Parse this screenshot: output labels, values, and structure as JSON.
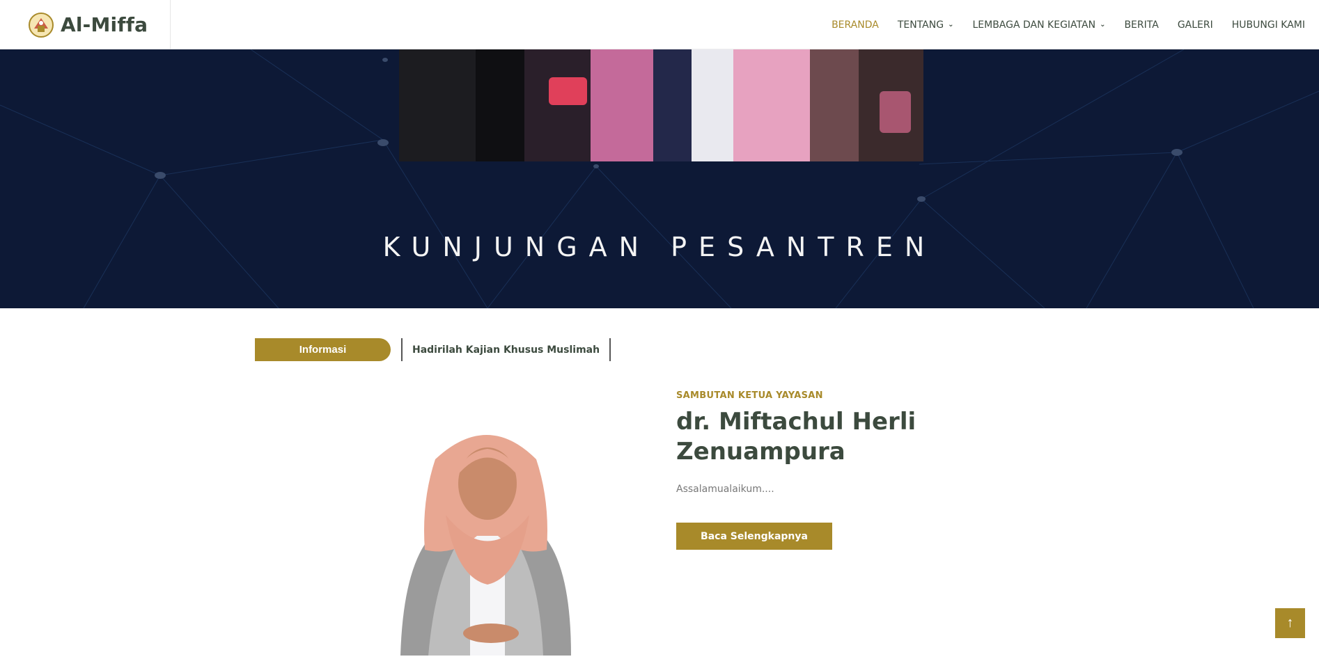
{
  "brand": {
    "name": "Al-Miffa",
    "logo_icon": "school-crest-icon"
  },
  "nav": {
    "items": [
      {
        "label": "BERANDA",
        "active": true
      },
      {
        "label": "TENTANG",
        "dropdown": true
      },
      {
        "label": "LEMBAGA DAN KEGIATAN",
        "dropdown": true
      },
      {
        "label": "BERITA"
      },
      {
        "label": "GALERI"
      },
      {
        "label": "HUBUNGI KAMI"
      }
    ]
  },
  "hero": {
    "title": "KUNJUNGAN PESANTREN"
  },
  "ticker": {
    "label": "Informasi",
    "message": "Hadirilah Kajian Khusus Muslimah"
  },
  "welcome": {
    "subtitle": "SAMBUTAN KETUA YAYASAN",
    "name": "dr. Miftachul Herli Zenuampura",
    "greeting": "Assalamualaikum....",
    "button": "Baca Selengkapnya"
  },
  "colors": {
    "accent": "#a88a2a",
    "hero_bg": "#0d1936",
    "text_dark": "#3c4a3e"
  },
  "icons": {
    "back_to_top": "arrow-up-icon",
    "dropdown": "chevron-down-icon"
  }
}
